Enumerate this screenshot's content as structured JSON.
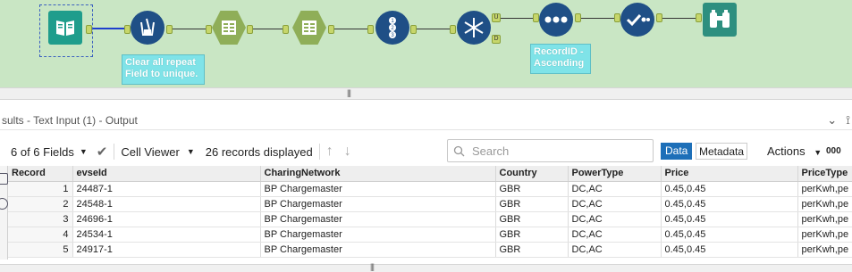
{
  "workflow": {
    "annotations": {
      "unique": "Clear all repeat Field to unique.",
      "sort": "RecordID - Ascending"
    },
    "join_anchor_u": "U",
    "join_anchor_d": "D"
  },
  "results": {
    "title": "sults - Text Input (1) - Output",
    "toolbar": {
      "fields": "6 of 6 Fields",
      "viewer": "Cell Viewer",
      "records": "26 records displayed",
      "search_placeholder": "Search",
      "data_tab": "Data",
      "metadata_tab": "Metadata",
      "actions": "Actions",
      "more": "000"
    },
    "columns": [
      "Record",
      "evseId",
      "CharingNetwork",
      "Country",
      "PowerType",
      "Price",
      "PriceType"
    ],
    "rows": [
      [
        "1",
        "24487-1",
        "BP Chargemaster",
        "GBR",
        "DC,AC",
        "0.45,0.45",
        "perKwh,pe"
      ],
      [
        "2",
        "24548-1",
        "BP Chargemaster",
        "GBR",
        "DC,AC",
        "0.45,0.45",
        "perKwh,pe"
      ],
      [
        "3",
        "24696-1",
        "BP Chargemaster",
        "GBR",
        "DC,AC",
        "0.45,0.45",
        "perKwh,pe"
      ],
      [
        "4",
        "24534-1",
        "BP Chargemaster",
        "GBR",
        "DC,AC",
        "0.45,0.45",
        "perKwh,pe"
      ],
      [
        "5",
        "24917-1",
        "BP Chargemaster",
        "GBR",
        "DC,AC",
        "0.45,0.45",
        "perKwh,pe"
      ]
    ]
  },
  "colors": {
    "canvas": "#c9e6c4",
    "tool_blue": "#1f4f86",
    "tool_green": "#8fae58",
    "annotation": "#7fe3e8",
    "accent": "#1d6fb8"
  }
}
